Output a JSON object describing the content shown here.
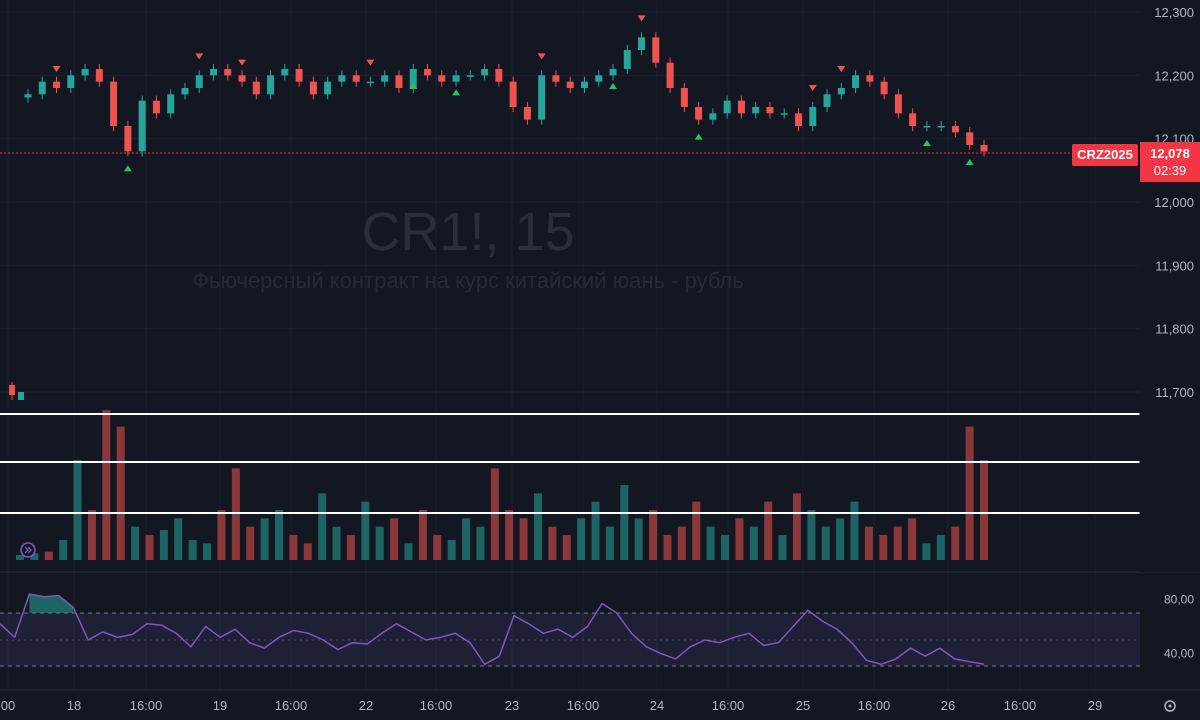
{
  "chart_data": {
    "type": "candlestick",
    "title": "CR1!, 15",
    "subtitle": "Фьючерсный контракт на курс китайский юань - рубль",
    "symbol_tag": "CRZ2025",
    "last_price": "12,078",
    "countdown": "02:39",
    "price_ylim": [
      11.513,
      12.3
    ],
    "price_ticks": [
      "12,300",
      "12,200",
      "12,100",
      "12,000",
      "11,900",
      "11,800",
      "11,700"
    ],
    "price_tick_values": [
      12.3,
      12.2,
      12.1,
      12.0,
      11.9,
      11.8,
      11.7
    ],
    "horizontal_levels": [
      {
        "label": "11,667",
        "value": 11.667
      },
      {
        "label": "11,593",
        "value": 11.593
      },
      {
        "label": "11,513",
        "value": 11.513
      }
    ],
    "x_ticks": [
      "00",
      "18",
      "16:00",
      "19",
      "16:00",
      "22",
      "16:00",
      "23",
      "16:00",
      "24",
      "16:00",
      "25",
      "16:00",
      "26",
      "16:00",
      "29"
    ],
    "close_series": [
      12.17,
      12.19,
      12.18,
      12.2,
      12.21,
      12.19,
      12.12,
      12.08,
      12.16,
      12.14,
      12.17,
      12.18,
      12.2,
      12.21,
      12.2,
      12.19,
      12.17,
      12.2,
      12.21,
      12.19,
      12.17,
      12.19,
      12.2,
      12.19,
      12.19,
      12.2,
      12.18,
      12.21,
      12.2,
      12.19,
      12.2,
      12.2,
      12.21,
      12.19,
      12.15,
      12.13,
      12.2,
      12.19,
      12.18,
      12.19,
      12.2,
      12.21,
      12.24,
      12.26,
      12.22,
      12.18,
      12.15,
      12.13,
      12.14,
      12.16,
      12.14,
      12.15,
      12.14,
      12.14,
      12.12,
      12.15,
      12.17,
      12.18,
      12.2,
      12.19,
      12.17,
      12.14,
      12.12,
      12.12,
      12.12,
      12.11,
      12.09,
      12.08
    ],
    "volume": [
      3,
      4,
      5,
      12,
      60,
      30,
      90,
      80,
      20,
      15,
      18,
      25,
      12,
      10,
      30,
      55,
      20,
      25,
      30,
      15,
      10,
      40,
      20,
      15,
      35,
      20,
      25,
      10,
      30,
      15,
      12,
      25,
      20,
      55,
      30,
      25,
      40,
      20,
      15,
      25,
      35,
      20,
      45,
      25,
      30,
      15,
      20,
      35,
      20,
      15,
      25,
      20,
      35,
      15,
      40,
      30,
      20,
      25,
      35,
      20,
      15,
      20,
      25,
      10,
      15,
      20,
      80,
      60
    ],
    "rsi": {
      "ticks": [
        "80,00",
        "40,00"
      ],
      "tick_values": [
        80,
        40
      ],
      "upper_band": 70,
      "lower_band": 30,
      "values": [
        62,
        52,
        84,
        82,
        83,
        74,
        50,
        56,
        52,
        54,
        62,
        61,
        55,
        45,
        60,
        52,
        58,
        48,
        44,
        52,
        57,
        55,
        50,
        43,
        48,
        47,
        55,
        62,
        56,
        50,
        52,
        55,
        48,
        32,
        38,
        68,
        62,
        55,
        58,
        52,
        60,
        77,
        70,
        55,
        45,
        40,
        36,
        45,
        50,
        48,
        52,
        55,
        46,
        48,
        60,
        72,
        64,
        58,
        48,
        35,
        32,
        36,
        44,
        38,
        44,
        36,
        34,
        32
      ]
    }
  }
}
